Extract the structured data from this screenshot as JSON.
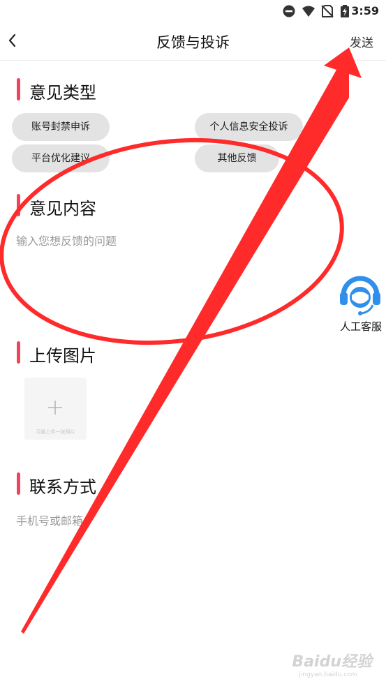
{
  "status_bar": {
    "time": "3:59",
    "icons": [
      "do-not-disturb-icon",
      "wifi-icon",
      "no-sim-icon",
      "battery-charging-icon"
    ]
  },
  "nav": {
    "back_icon": "chevron-left-icon",
    "title": "反馈与投诉",
    "send_label": "发送"
  },
  "sections": {
    "type_title": "意见类型",
    "content_title": "意见内容",
    "upload_title": "上传图片",
    "contact_title": "联系方式"
  },
  "feedback_types": [
    "账号封禁申诉",
    "个人信息安全投诉",
    "平台优化建议",
    "其他反馈"
  ],
  "content": {
    "placeholder": "输入您想反馈的问题"
  },
  "upload": {
    "icon": "plus-icon",
    "hint": "可最上传一张照片"
  },
  "contact": {
    "placeholder": "手机号或邮箱"
  },
  "customer_service": {
    "icon": "headset-agent-icon",
    "label": "人工客服"
  },
  "watermark": {
    "brand": "Baidu经验",
    "url": "jingyan.baidu.com"
  },
  "colors": {
    "accent": "#f0445a",
    "chip_bg": "#e3e3e3",
    "annotation_red": "#ff2a2a",
    "cs_blue": "#2f8fea"
  }
}
